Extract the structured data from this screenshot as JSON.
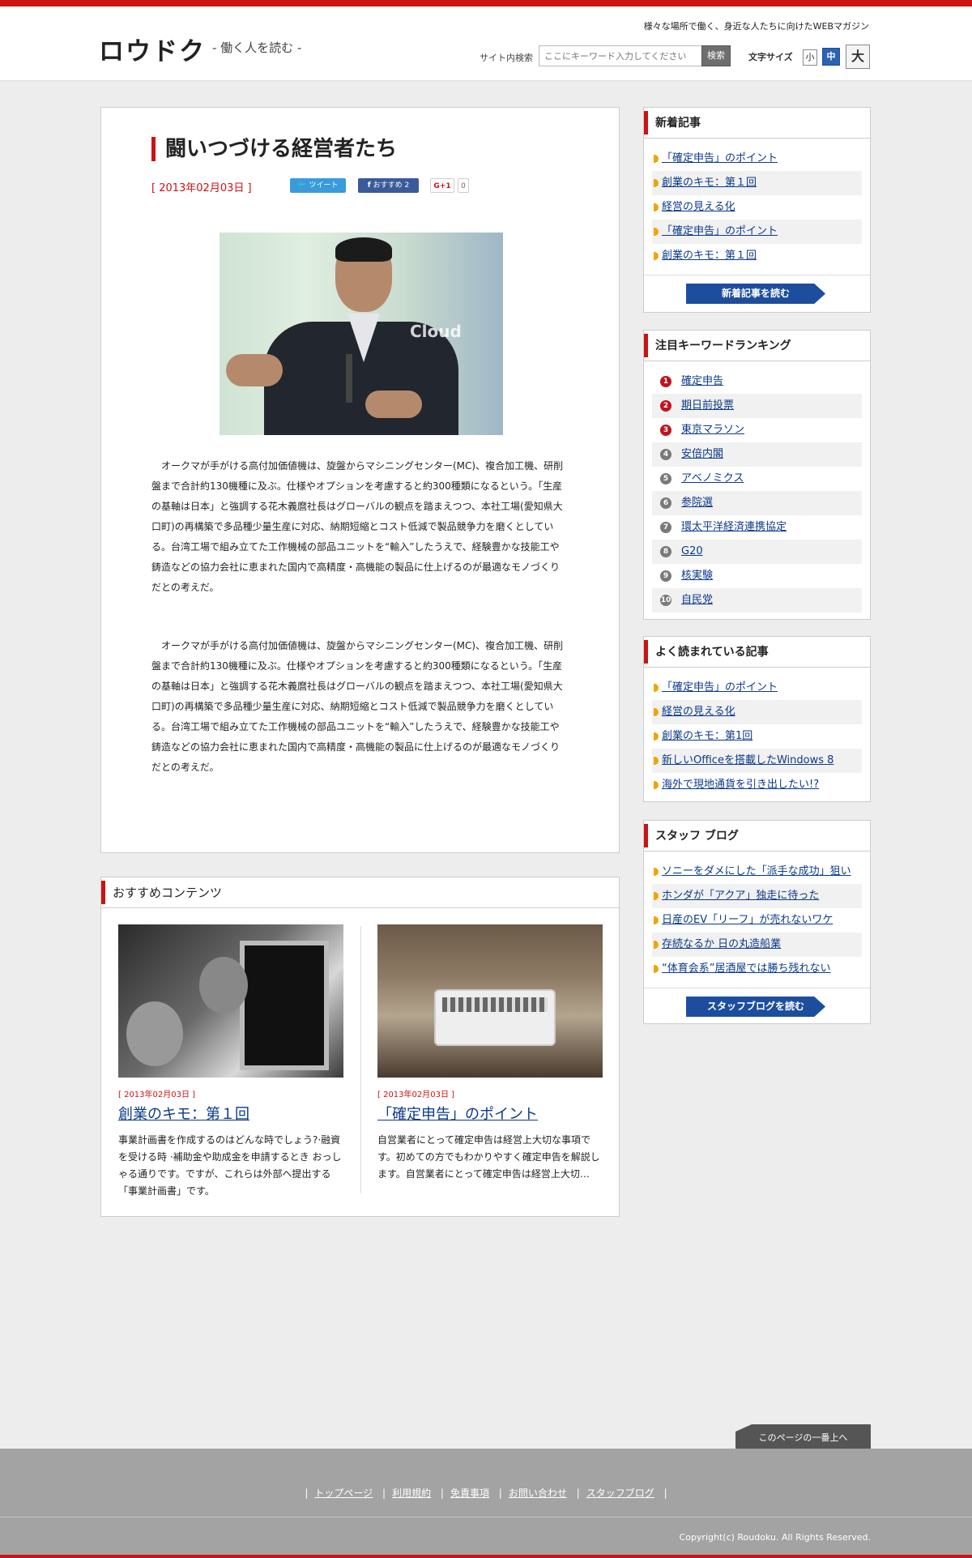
{
  "header": {
    "logo": "ロウドク",
    "logo_sub": "- 働く人を読む -",
    "tagline": "様々な場所で働く、身近な人たちに向けたWEBマガジン",
    "search_label": "サイト内検索",
    "search_placeholder": "ここにキーワード入力してください",
    "search_button": "検索",
    "fontsize_label": "文字サイズ",
    "fontsize_small": "小",
    "fontsize_medium": "中",
    "fontsize_large": "大"
  },
  "article": {
    "title": "闘いつづける経営者たち",
    "date": "[ 2013年02月03日 ]",
    "tweet": "ツイート",
    "facebook": "おすすめ 2",
    "gplus": "G+1",
    "gplus_count": "0",
    "photo_text": "Cloud",
    "paragraphs": [
      "オークマが手がける高付加価値機は、旋盤からマシニングセンター(MC)、複合加工機、研削盤まで合計約130機種に及ぶ。仕様やオプションを考慮すると約300種類になるという。「生産の基軸は日本」と強調する花木義麿社長はグローバルの観点を踏まえつつ、本社工場(愛知県大口町)の再構築で多品種少量生産に対応、納期短縮とコスト低減で製品競争力を磨くとしている。台湾工場で組み立てた工作機械の部品ユニットを“輸入”したうえで、経験豊かな技能工や鋳造などの協力会社に恵まれた国内で高精度・高機能の製品に仕上げるのが最適なモノづくりだとの考えだ。",
      "オークマが手がける高付加価値機は、旋盤からマシニングセンター(MC)、複合加工機、研削盤まで合計約130機種に及ぶ。仕様やオプションを考慮すると約300種類になるという。「生産の基軸は日本」と強調する花木義麿社長はグローバルの観点を踏まえつつ、本社工場(愛知県大口町)の再構築で多品種少量生産に対応、納期短縮とコスト低減で製品競争力を磨くとしている。台湾工場で組み立てた工作機械の部品ユニットを“輸入”したうえで、経験豊かな技能工や鋳造などの協力会社に恵まれた国内で高精度・高機能の製品に仕上げるのが最適なモノづくりだとの考えだ。"
    ]
  },
  "recommended": {
    "heading": "おすすめコンテンツ",
    "items": [
      {
        "date": "[ 2013年02月03日 ]",
        "title": "創業のキモ：第１回",
        "text": "事業計画書を作成するのはどんな時でしょう?·融資を受ける時 ·補助金や助成金を申請するとき おっしゃる通りです。ですが、これらは外部へ提出する「事業計画書」です。"
      },
      {
        "date": "[ 2013年02月03日 ]",
        "title": "「確定申告」のポイント",
        "text": "自営業者にとって確定申告は経営上大切な事項です。初めての方でもわかりやすく確定申告を解説します。自営業者にとって確定申告は経営上大切…"
      }
    ]
  },
  "sidebar": {
    "new_articles": {
      "heading": "新着記事",
      "items": [
        "「確定申告」のポイント",
        "創業のキモ：第１回",
        "経営の見える化",
        "「確定申告」のポイント",
        "創業のキモ：第１回"
      ],
      "more": "新着記事を読む"
    },
    "ranking": {
      "heading": "注目キーワードランキング",
      "items": [
        {
          "rank": "1",
          "label": "確定申告"
        },
        {
          "rank": "2",
          "label": "期日前投票"
        },
        {
          "rank": "3",
          "label": "東京マラソン"
        },
        {
          "rank": "4",
          "label": "安倍内閣"
        },
        {
          "rank": "5",
          "label": "アベノミクス"
        },
        {
          "rank": "6",
          "label": "参院選"
        },
        {
          "rank": "7",
          "label": "環太平洋経済連携協定"
        },
        {
          "rank": "8",
          "label": "G20"
        },
        {
          "rank": "9",
          "label": "核実験"
        },
        {
          "rank": "10",
          "label": "自民党"
        }
      ]
    },
    "popular": {
      "heading": "よく読まれている記事",
      "items": [
        "「確定申告」のポイント",
        "経営の見える化",
        "創業のキモ：第1回",
        "新しいOfficeを搭載したWindows 8",
        "海外で現地通貨を引き出したい!?"
      ]
    },
    "staff_blog": {
      "heading": "スタッフ ブログ",
      "items": [
        "ソニーをダメにした「派手な成功」狙い",
        "ホンダが「アクア」独走に待った",
        "日産のEV「リーフ」が売れないワケ",
        "存続なるか 日の丸造船業",
        "“体育会系”居酒屋では勝ち残れない"
      ],
      "more": "スタッフブログを読む"
    }
  },
  "footer": {
    "pagetop": "このページの一番上へ",
    "links": [
      "トップページ",
      "利用規約",
      "免責事項",
      "お問い合わせ",
      "スタッフブログ"
    ],
    "copyright": "Copyright(c) Roudoku. All Rights Reserved."
  }
}
